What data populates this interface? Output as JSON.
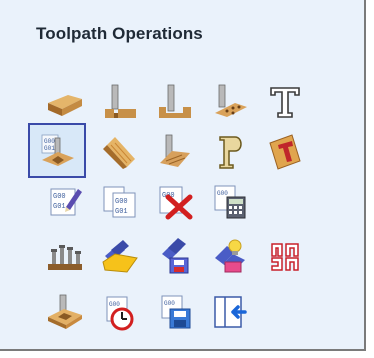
{
  "panel": {
    "title": "Toolpath Operations"
  },
  "colors": {
    "panel_background": "#eaf2fb",
    "selection_border": "#3a4aa8",
    "title_text": "#1f2a36"
  },
  "tools": [
    {
      "icon": "material-setup-icon",
      "selected": false
    },
    {
      "icon": "profile-toolpath-icon",
      "selected": false
    },
    {
      "icon": "pocket-toolpath-icon",
      "selected": false
    },
    {
      "icon": "drilling-toolpath-icon",
      "selected": false
    },
    {
      "icon": "v-carve-text-icon",
      "selected": false
    },
    {
      "icon": "3d-toolpath-icon",
      "selected": true
    },
    {
      "icon": "fluting-toolpath-icon",
      "selected": false
    },
    {
      "icon": "texture-toolpath-icon",
      "selected": false
    },
    {
      "icon": "prism-carving-icon",
      "selected": false
    },
    {
      "icon": "inlay-toolpath-icon",
      "selected": false
    },
    {
      "icon": "edit-gcode-icon",
      "selected": false
    },
    {
      "icon": "recalculate-gcode-icon",
      "selected": false
    },
    {
      "icon": "delete-toolpath-icon",
      "selected": false
    },
    {
      "icon": "toolpath-summary-icon",
      "selected": false
    },
    {
      "icon": "tool-database-icon",
      "selected": false
    },
    {
      "icon": "folder-templates-icon",
      "selected": false
    },
    {
      "icon": "save-template-icon",
      "selected": false
    },
    {
      "icon": "merge-template-icon",
      "selected": false
    },
    {
      "icon": "nesting-icon",
      "selected": false
    },
    {
      "icon": "preview-toolpath-icon",
      "selected": false
    },
    {
      "icon": "estimate-time-icon",
      "selected": false
    },
    {
      "icon": "save-toolpath-icon",
      "selected": false
    },
    {
      "icon": "import-toolpath-icon",
      "selected": false
    }
  ]
}
